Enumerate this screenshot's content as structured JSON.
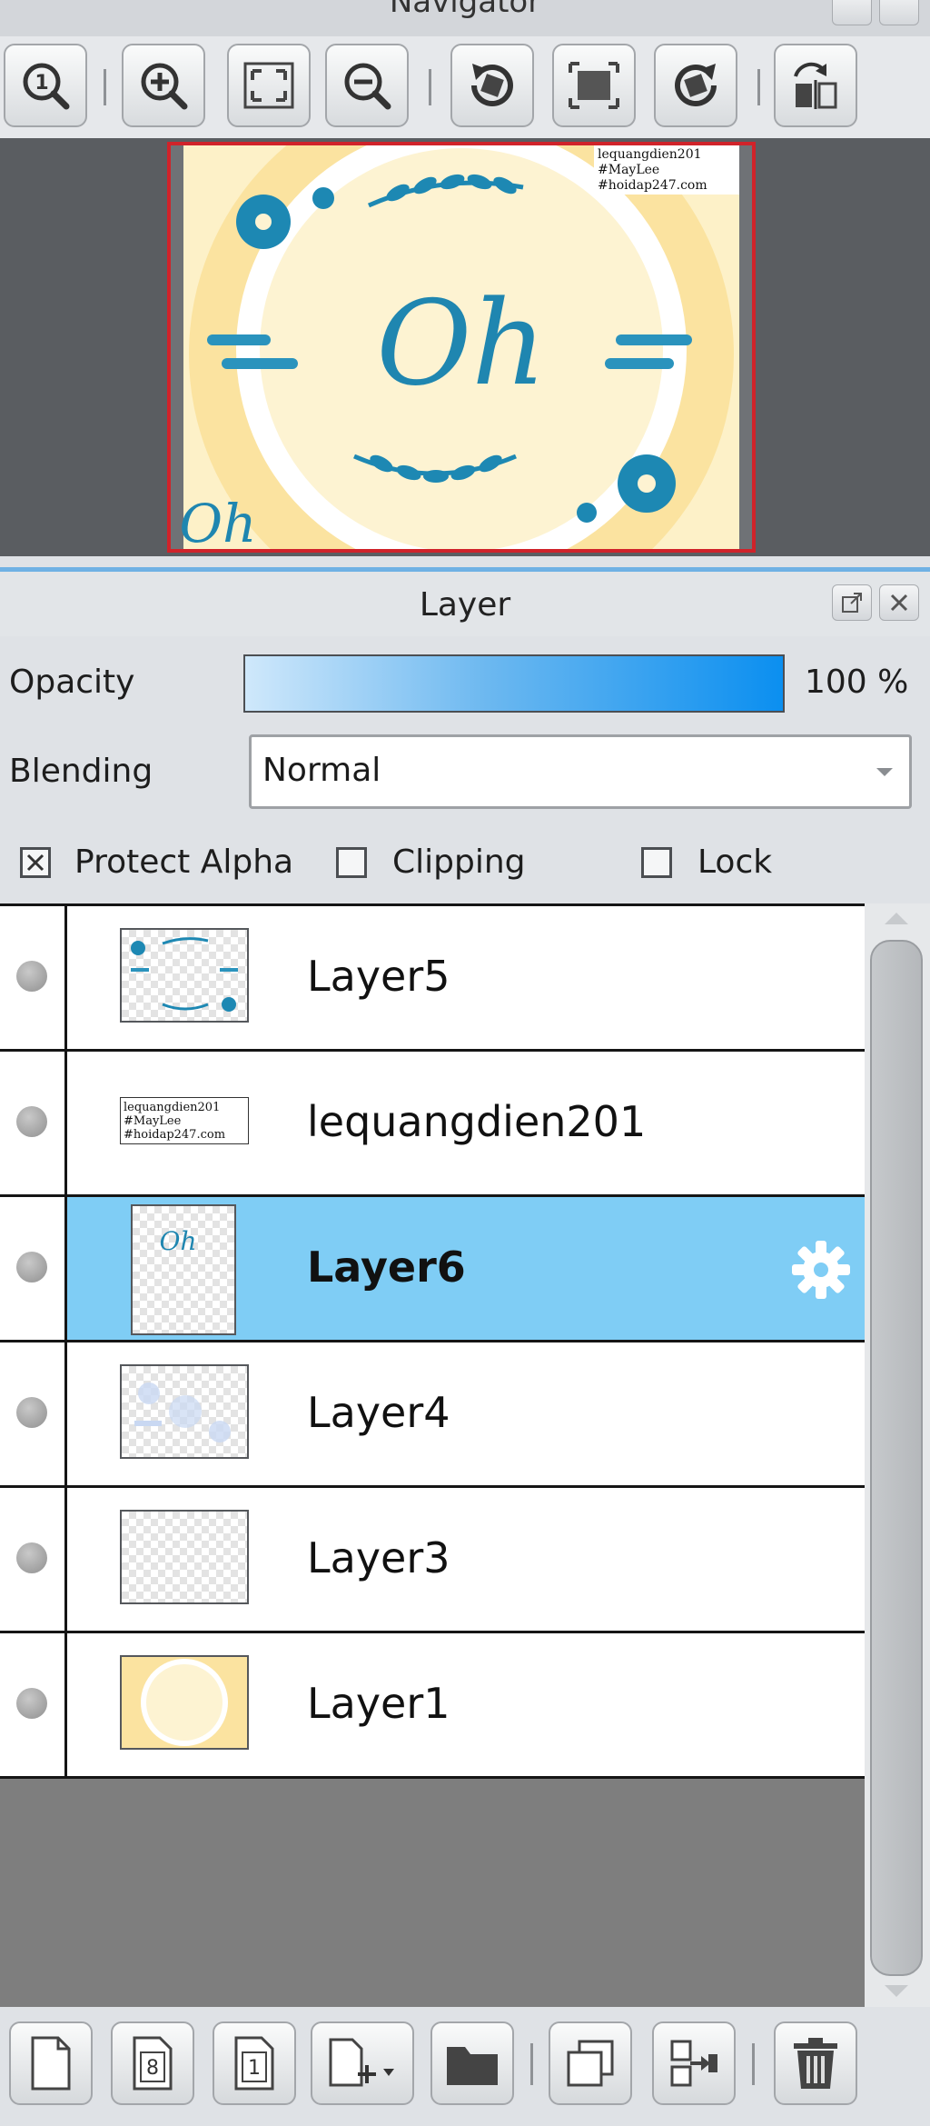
{
  "navigator": {
    "title": "Navigator",
    "toolbar": [
      {
        "name": "zoom-actual-icon",
        "glyph": "1"
      },
      {
        "name": "zoom-in-icon"
      },
      {
        "name": "fit-window-icon"
      },
      {
        "name": "zoom-out-icon"
      },
      {
        "name": "rotate-left-icon"
      },
      {
        "name": "fit-canvas-icon"
      },
      {
        "name": "rotate-right-icon"
      },
      {
        "name": "flip-horizontal-icon"
      }
    ],
    "preview": {
      "watermark_lines": [
        "lequangdien201",
        "#MayLee",
        "#hoidap247.com"
      ],
      "center_text": "Oh",
      "corner_text": "Oh"
    }
  },
  "layer_panel": {
    "title": "Layer",
    "opacity_label": "Opacity",
    "opacity_value": "100 %",
    "blending_label": "Blending",
    "blending_value": "Normal",
    "protect_alpha_label": "Protect Alpha",
    "protect_alpha_checked": true,
    "clipping_label": "Clipping",
    "clipping_checked": false,
    "lock_label": "Lock",
    "lock_checked": false,
    "layers": [
      {
        "name": "Layer5",
        "selected": false
      },
      {
        "name": "lequangdien201",
        "selected": false
      },
      {
        "name": "Layer6",
        "selected": true
      },
      {
        "name": "Layer4",
        "selected": false
      },
      {
        "name": "Layer3",
        "selected": false
      },
      {
        "name": "Layer1",
        "selected": false
      }
    ],
    "layer6_thumb_text": "Oh",
    "bottom_toolbar": [
      {
        "name": "new-layer-icon"
      },
      {
        "name": "new-8bit-layer-icon",
        "glyph": "8"
      },
      {
        "name": "new-1bit-layer-icon",
        "glyph": "1"
      },
      {
        "name": "add-layer-menu-icon"
      },
      {
        "name": "new-folder-icon"
      },
      {
        "name": "duplicate-layer-icon"
      },
      {
        "name": "merge-layer-icon"
      },
      {
        "name": "delete-layer-icon"
      }
    ]
  },
  "colors": {
    "selected_row": "#7fcdf5",
    "opacity_bar_end": "#0b8ff0",
    "preview_border": "#d0232a",
    "panel_accent": "#6fb1e4"
  }
}
